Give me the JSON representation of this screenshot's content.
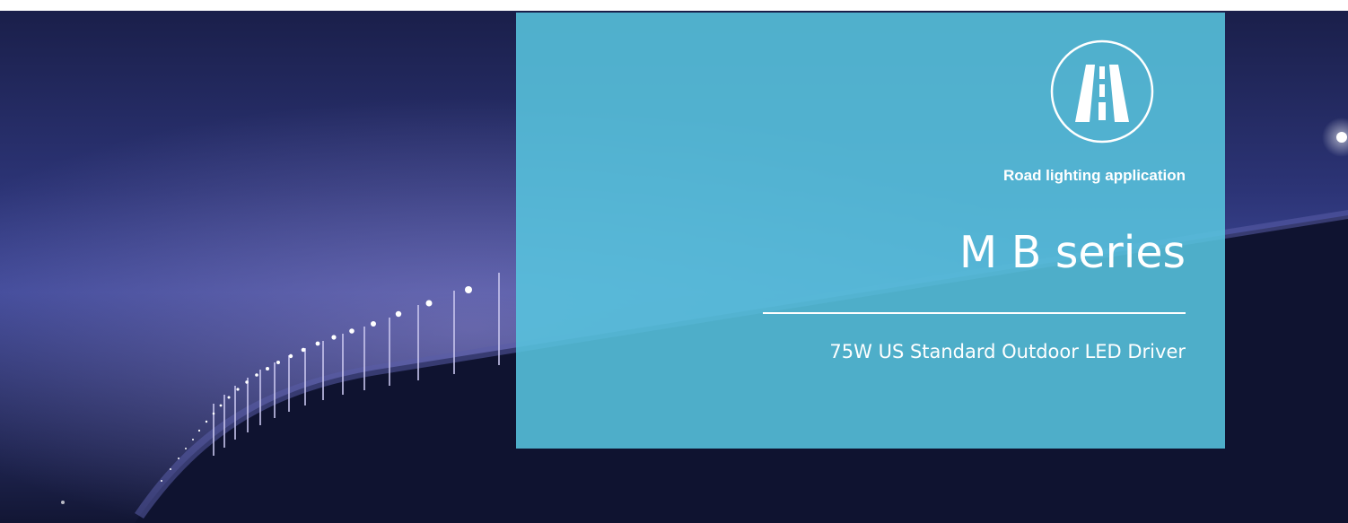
{
  "banner": {
    "application_label": "Road lighting application",
    "series_title": "M B series",
    "product_subtitle": "75W US Standard Outdoor LED Driver",
    "icon": "road-icon",
    "panel_color": "#58c4de",
    "text_color": "#ffffff",
    "background_image": "bridge-street-lights-night"
  }
}
